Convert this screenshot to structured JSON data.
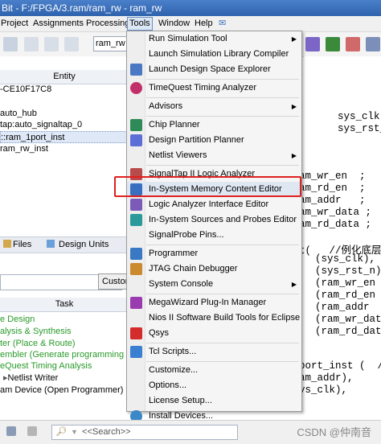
{
  "window": {
    "title": "Bit - F:/FPGA/3.ram/ram_rw - ram_rw"
  },
  "menubar": {
    "items": [
      "Project",
      "Assignments",
      "Processing",
      "Tools",
      "Window",
      "Help"
    ],
    "active": "Tools"
  },
  "toolbar": {
    "combo_value": "ram_rw"
  },
  "left_panel": {
    "entity_header": "Entity",
    "entities": [
      "-CE10F17C8",
      "auto_hub",
      "tap:auto_signaltap_0",
      "::ram_1port_inst",
      "ram_rw_inst"
    ],
    "tabs": [
      "Files",
      "Design Units"
    ],
    "custom_button": "Custom",
    "task_header": "Task",
    "tasks": [
      "e Design",
      "alysis & Synthesis",
      "ter (Place & Route)",
      "embler (Generate programming files)",
      "eQuest Timing Analysis",
      "Netlist Writer",
      "am Device (Open Programmer)"
    ]
  },
  "tools_menu": {
    "items": [
      {
        "label": "Run Simulation Tool",
        "submenu": true,
        "icon": "blank"
      },
      {
        "label": "Launch Simulation Library Compiler",
        "submenu": false,
        "icon": "blank"
      },
      {
        "label": "Launch Design Space Explorer",
        "submenu": false,
        "icon": "dse-icon"
      },
      {
        "label": "TimeQuest Timing Analyzer",
        "submenu": false,
        "icon": "clock-icon"
      },
      {
        "label": "Advisors",
        "submenu": true,
        "icon": "blank"
      },
      {
        "label": "Chip Planner",
        "submenu": false,
        "icon": "chip-icon"
      },
      {
        "label": "Design Partition Planner",
        "submenu": false,
        "icon": "partition-icon"
      },
      {
        "label": "Netlist Viewers",
        "submenu": true,
        "icon": "blank"
      },
      {
        "label": "SignalTap II Logic Analyzer",
        "submenu": false,
        "icon": "signaltap-icon"
      },
      {
        "label": "In-System Memory Content Editor",
        "submenu": false,
        "icon": "memory-icon"
      },
      {
        "label": "Logic Analyzer Interface Editor",
        "submenu": false,
        "icon": "lai-icon"
      },
      {
        "label": "In-System Sources and Probes Editor",
        "submenu": false,
        "icon": "probe-icon"
      },
      {
        "label": "SignalProbe Pins...",
        "submenu": false,
        "icon": "blank"
      },
      {
        "label": "Programmer",
        "submenu": false,
        "icon": "programmer-icon"
      },
      {
        "label": "JTAG Chain Debugger",
        "submenu": false,
        "icon": "jtag-icon"
      },
      {
        "label": "System Console",
        "submenu": true,
        "icon": "blank"
      },
      {
        "label": "MegaWizard Plug-In Manager",
        "submenu": false,
        "icon": "wizard-icon"
      },
      {
        "label": "Nios II Software Build Tools for Eclipse",
        "submenu": false,
        "icon": "blank"
      },
      {
        "label": "Qsys",
        "submenu": false,
        "icon": "qsys-icon"
      },
      {
        "label": "Tcl Scripts...",
        "submenu": false,
        "icon": "tcl-icon"
      },
      {
        "label": "Customize...",
        "submenu": false,
        "icon": "blank"
      },
      {
        "label": "Options...",
        "submenu": false,
        "icon": "blank"
      },
      {
        "label": "License Setup...",
        "submenu": false,
        "icon": "blank"
      },
      {
        "label": "Install Devices...",
        "submenu": false,
        "icon": "globe-icon"
      }
    ],
    "highlighted": "In-System Memory Content Editor"
  },
  "editor": {
    "lines": [
      "sys_clk",
      "sys_rst_",
      "am_wr_en  ;",
      "am_rd_en  ;",
      "am_addr   ;",
      "am_wr_data ;",
      "am_rd_data ;",
      "t(   //例化底层",
      "(sys_clk),",
      "(sys_rst_n)",
      "(ram_wr_en",
      "(ram_rd_en",
      "(ram_addr",
      "(ram_wr_dat",
      "(ram_rd_dat",
      "port_inst (  /",
      "am_addr),",
      "ys_clk),"
    ]
  },
  "bottom": {
    "search_placeholder": "<<Search>>",
    "watermark": "CSDN @仲南音"
  },
  "colors": {
    "highlight_box": "#e0201e",
    "title_bar": "#2f63ad",
    "task_green": "#2a9a2a"
  }
}
